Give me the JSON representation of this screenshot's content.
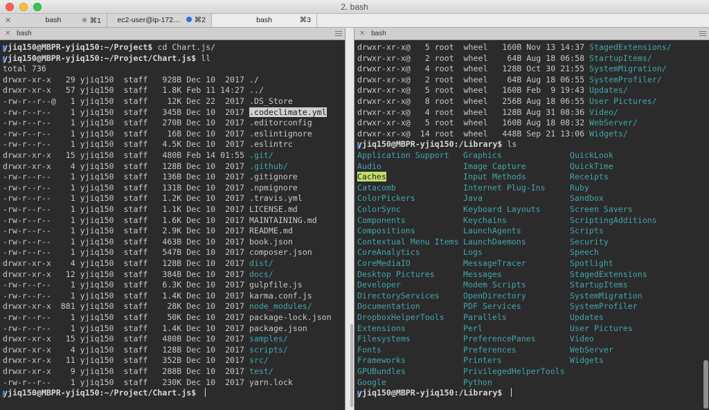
{
  "window": {
    "title": "2. bash"
  },
  "tabs": [
    {
      "label": "bash",
      "shortcut": "⌘1",
      "spinner": true
    },
    {
      "label": "ec2-user@ip-172…",
      "shortcut": "⌘2",
      "dot": true
    },
    {
      "label": "bash",
      "shortcut": "⌘3",
      "active": true
    }
  ],
  "left_pane": {
    "header": "bash",
    "prompt_host": "yjiq150@MBPR-yjiq150",
    "lines": [
      {
        "type": "cmd",
        "path": ":~/Project$ ",
        "cmd": "cd Chart.js/"
      },
      {
        "type": "cmd",
        "path": ":~/Project/Chart.js$ ",
        "cmd": "ll"
      },
      {
        "type": "text",
        "text": "total 736"
      },
      {
        "type": "entry",
        "meta": "drwxr-xr-x   29 yjiq150  staff   928B Dec 10  2017 ",
        "name": "./",
        "kind": "plain"
      },
      {
        "type": "entry",
        "meta": "drwxr-xr-x   57 yjiq150  staff   1.8K Feb 11 14:27 ",
        "name": "../",
        "kind": "plain"
      },
      {
        "type": "entry",
        "meta": "-rw-r--r--@   1 yjiq150  staff    12K Dec 22  2017 ",
        "name": ".DS_Store",
        "kind": "plain"
      },
      {
        "type": "entry",
        "meta": "-rw-r--r--    1 yjiq150  staff   345B Dec 10  2017 ",
        "name": ".codeclimate.yml",
        "kind": "sel"
      },
      {
        "type": "entry",
        "meta": "-rw-r--r--    1 yjiq150  staff   270B Dec 10  2017 ",
        "name": ".editorconfig",
        "kind": "plain"
      },
      {
        "type": "entry",
        "meta": "-rw-r--r--    1 yjiq150  staff    16B Dec 10  2017 ",
        "name": ".eslintignore",
        "kind": "plain"
      },
      {
        "type": "entry",
        "meta": "-rw-r--r--    1 yjiq150  staff   4.5K Dec 10  2017 ",
        "name": ".eslintrc",
        "kind": "plain"
      },
      {
        "type": "entry",
        "meta": "drwxr-xr-x   15 yjiq150  staff   480B Feb 14 01:55 ",
        "name": ".git/",
        "kind": "dir"
      },
      {
        "type": "entry",
        "meta": "drwxr-xr-x    4 yjiq150  staff   128B Dec 10  2017 ",
        "name": ".github/",
        "kind": "dir"
      },
      {
        "type": "entry",
        "meta": "-rw-r--r--    1 yjiq150  staff   136B Dec 10  2017 ",
        "name": ".gitignore",
        "kind": "plain"
      },
      {
        "type": "entry",
        "meta": "-rw-r--r--    1 yjiq150  staff   131B Dec 10  2017 ",
        "name": ".npmignore",
        "kind": "plain"
      },
      {
        "type": "entry",
        "meta": "-rw-r--r--    1 yjiq150  staff   1.2K Dec 10  2017 ",
        "name": ".travis.yml",
        "kind": "plain"
      },
      {
        "type": "entry",
        "meta": "-rw-r--r--    1 yjiq150  staff   1.1K Dec 10  2017 ",
        "name": "LICENSE.md",
        "kind": "plain"
      },
      {
        "type": "entry",
        "meta": "-rw-r--r--    1 yjiq150  staff   1.6K Dec 10  2017 ",
        "name": "MAINTAINING.md",
        "kind": "plain"
      },
      {
        "type": "entry",
        "meta": "-rw-r--r--    1 yjiq150  staff   2.9K Dec 10  2017 ",
        "name": "README.md",
        "kind": "plain"
      },
      {
        "type": "entry",
        "meta": "-rw-r--r--    1 yjiq150  staff   463B Dec 10  2017 ",
        "name": "book.json",
        "kind": "plain"
      },
      {
        "type": "entry",
        "meta": "-rw-r--r--    1 yjiq150  staff   547B Dec 10  2017 ",
        "name": "composer.json",
        "kind": "plain"
      },
      {
        "type": "entry",
        "meta": "drwxr-xr-x    4 yjiq150  staff   128B Dec 10  2017 ",
        "name": "dist/",
        "kind": "dir"
      },
      {
        "type": "entry",
        "meta": "drwxr-xr-x   12 yjiq150  staff   384B Dec 10  2017 ",
        "name": "docs/",
        "kind": "dir"
      },
      {
        "type": "entry",
        "meta": "-rw-r--r--    1 yjiq150  staff   6.3K Dec 10  2017 ",
        "name": "gulpfile.js",
        "kind": "plain"
      },
      {
        "type": "entry",
        "meta": "-rw-r--r--    1 yjiq150  staff   1.4K Dec 10  2017 ",
        "name": "karma.conf.js",
        "kind": "plain"
      },
      {
        "type": "entry",
        "meta": "drwxr-xr-x  881 yjiq150  staff    28K Dec 10  2017 ",
        "name": "node_modules/",
        "kind": "dir"
      },
      {
        "type": "entry",
        "meta": "-rw-r--r--    1 yjiq150  staff    50K Dec 10  2017 ",
        "name": "package-lock.json",
        "kind": "plain"
      },
      {
        "type": "entry",
        "meta": "-rw-r--r--    1 yjiq150  staff   1.4K Dec 10  2017 ",
        "name": "package.json",
        "kind": "plain"
      },
      {
        "type": "entry",
        "meta": "drwxr-xr-x   15 yjiq150  staff   480B Dec 10  2017 ",
        "name": "samples/",
        "kind": "dir"
      },
      {
        "type": "entry",
        "meta": "drwxr-xr-x    4 yjiq150  staff   128B Dec 10  2017 ",
        "name": "scripts/",
        "kind": "dir"
      },
      {
        "type": "entry",
        "meta": "drwxr-xr-x   11 yjiq150  staff   352B Dec 10  2017 ",
        "name": "src/",
        "kind": "dir"
      },
      {
        "type": "entry",
        "meta": "drwxr-xr-x    9 yjiq150  staff   288B Dec 10  2017 ",
        "name": "test/",
        "kind": "dir"
      },
      {
        "type": "entry",
        "meta": "-rw-r--r--    1 yjiq150  staff   230K Dec 10  2017 ",
        "name": "yarn.lock",
        "kind": "plain"
      },
      {
        "type": "prompt",
        "path": ":~/Project/Chart.js$ ",
        "cmd": ""
      }
    ]
  },
  "right_pane": {
    "header": "bash",
    "prompt_host": "yjiq150@MBPR-yjiq150",
    "entries": [
      {
        "meta": "drwxr-xr-x@   5 root  wheel   160B Nov 13 14:37 ",
        "name": "StagedExtensions/"
      },
      {
        "meta": "drwxr-xr-x@   2 root  wheel    64B Aug 18 06:58 ",
        "name": "StartupItems/"
      },
      {
        "meta": "drwxr-xr-x@   4 root  wheel   128B Oct 30 21:55 ",
        "name": "SystemMigration/"
      },
      {
        "meta": "drwxr-xr-x@   2 root  wheel    64B Aug 18 06:55 ",
        "name": "SystemProfiler/"
      },
      {
        "meta": "drwxr-xr-x@   5 root  wheel   160B Feb  9 19:43 ",
        "name": "Updates/"
      },
      {
        "meta": "drwxr-xr-x@   8 root  wheel   256B Aug 18 06:55 ",
        "name": "User Pictures/"
      },
      {
        "meta": "drwxr-xr-x@   4 root  wheel   128B Aug 31 08:36 ",
        "name": "Video/"
      },
      {
        "meta": "drwxr-xr-x@   5 root  wheel   160B Aug 18 08:32 ",
        "name": "WebServer/"
      },
      {
        "meta": "drwxr-xr-x@  14 root  wheel   448B Sep 21 13:06 ",
        "name": "Widgets/"
      }
    ],
    "ls_prompt": {
      "path": ":/Library$ ",
      "cmd": "ls"
    },
    "ls_columns": [
      [
        "Application Support",
        "Audio",
        "Caches",
        "Catacomb",
        "ColorPickers",
        "ColorSync",
        "Components",
        "Compositions",
        "Contextual Menu Items",
        "CoreAnalytics",
        "CoreMediaIO",
        "Desktop Pictures",
        "Developer",
        "DirectoryServices",
        "Documentation",
        "DropboxHelperTools",
        "Extensions",
        "Filesystems",
        "Fonts",
        "Frameworks",
        "GPUBundles",
        "Google"
      ],
      [
        "Graphics",
        "Image Capture",
        "Input Methods",
        "Internet Plug-Ins",
        "Java",
        "Keyboard Layouts",
        "Keychains",
        "LaunchAgents",
        "LaunchDaemons",
        "Logs",
        "MessageTracer",
        "Messages",
        "Modem Scripts",
        "OpenDirectory",
        "PDF Services",
        "Parallels",
        "Perl",
        "PreferencePanes",
        "Preferences",
        "Printers",
        "PrivilegedHelperTools",
        "Python"
      ],
      [
        "QuickLook",
        "QuickTime",
        "Receipts",
        "Ruby",
        "Sandbox",
        "Screen Savers",
        "ScriptingAdditions",
        "Scripts",
        "Security",
        "Speech",
        "Spotlight",
        "StagedExtensions",
        "StartupItems",
        "SystemMigration",
        "SystemProfiler",
        "Updates",
        "User Pictures",
        "Video",
        "WebServer",
        "Widgets"
      ]
    ],
    "highlighted": "Caches",
    "final_prompt": {
      "path": ":/Library$ ",
      "cmd": ""
    }
  }
}
